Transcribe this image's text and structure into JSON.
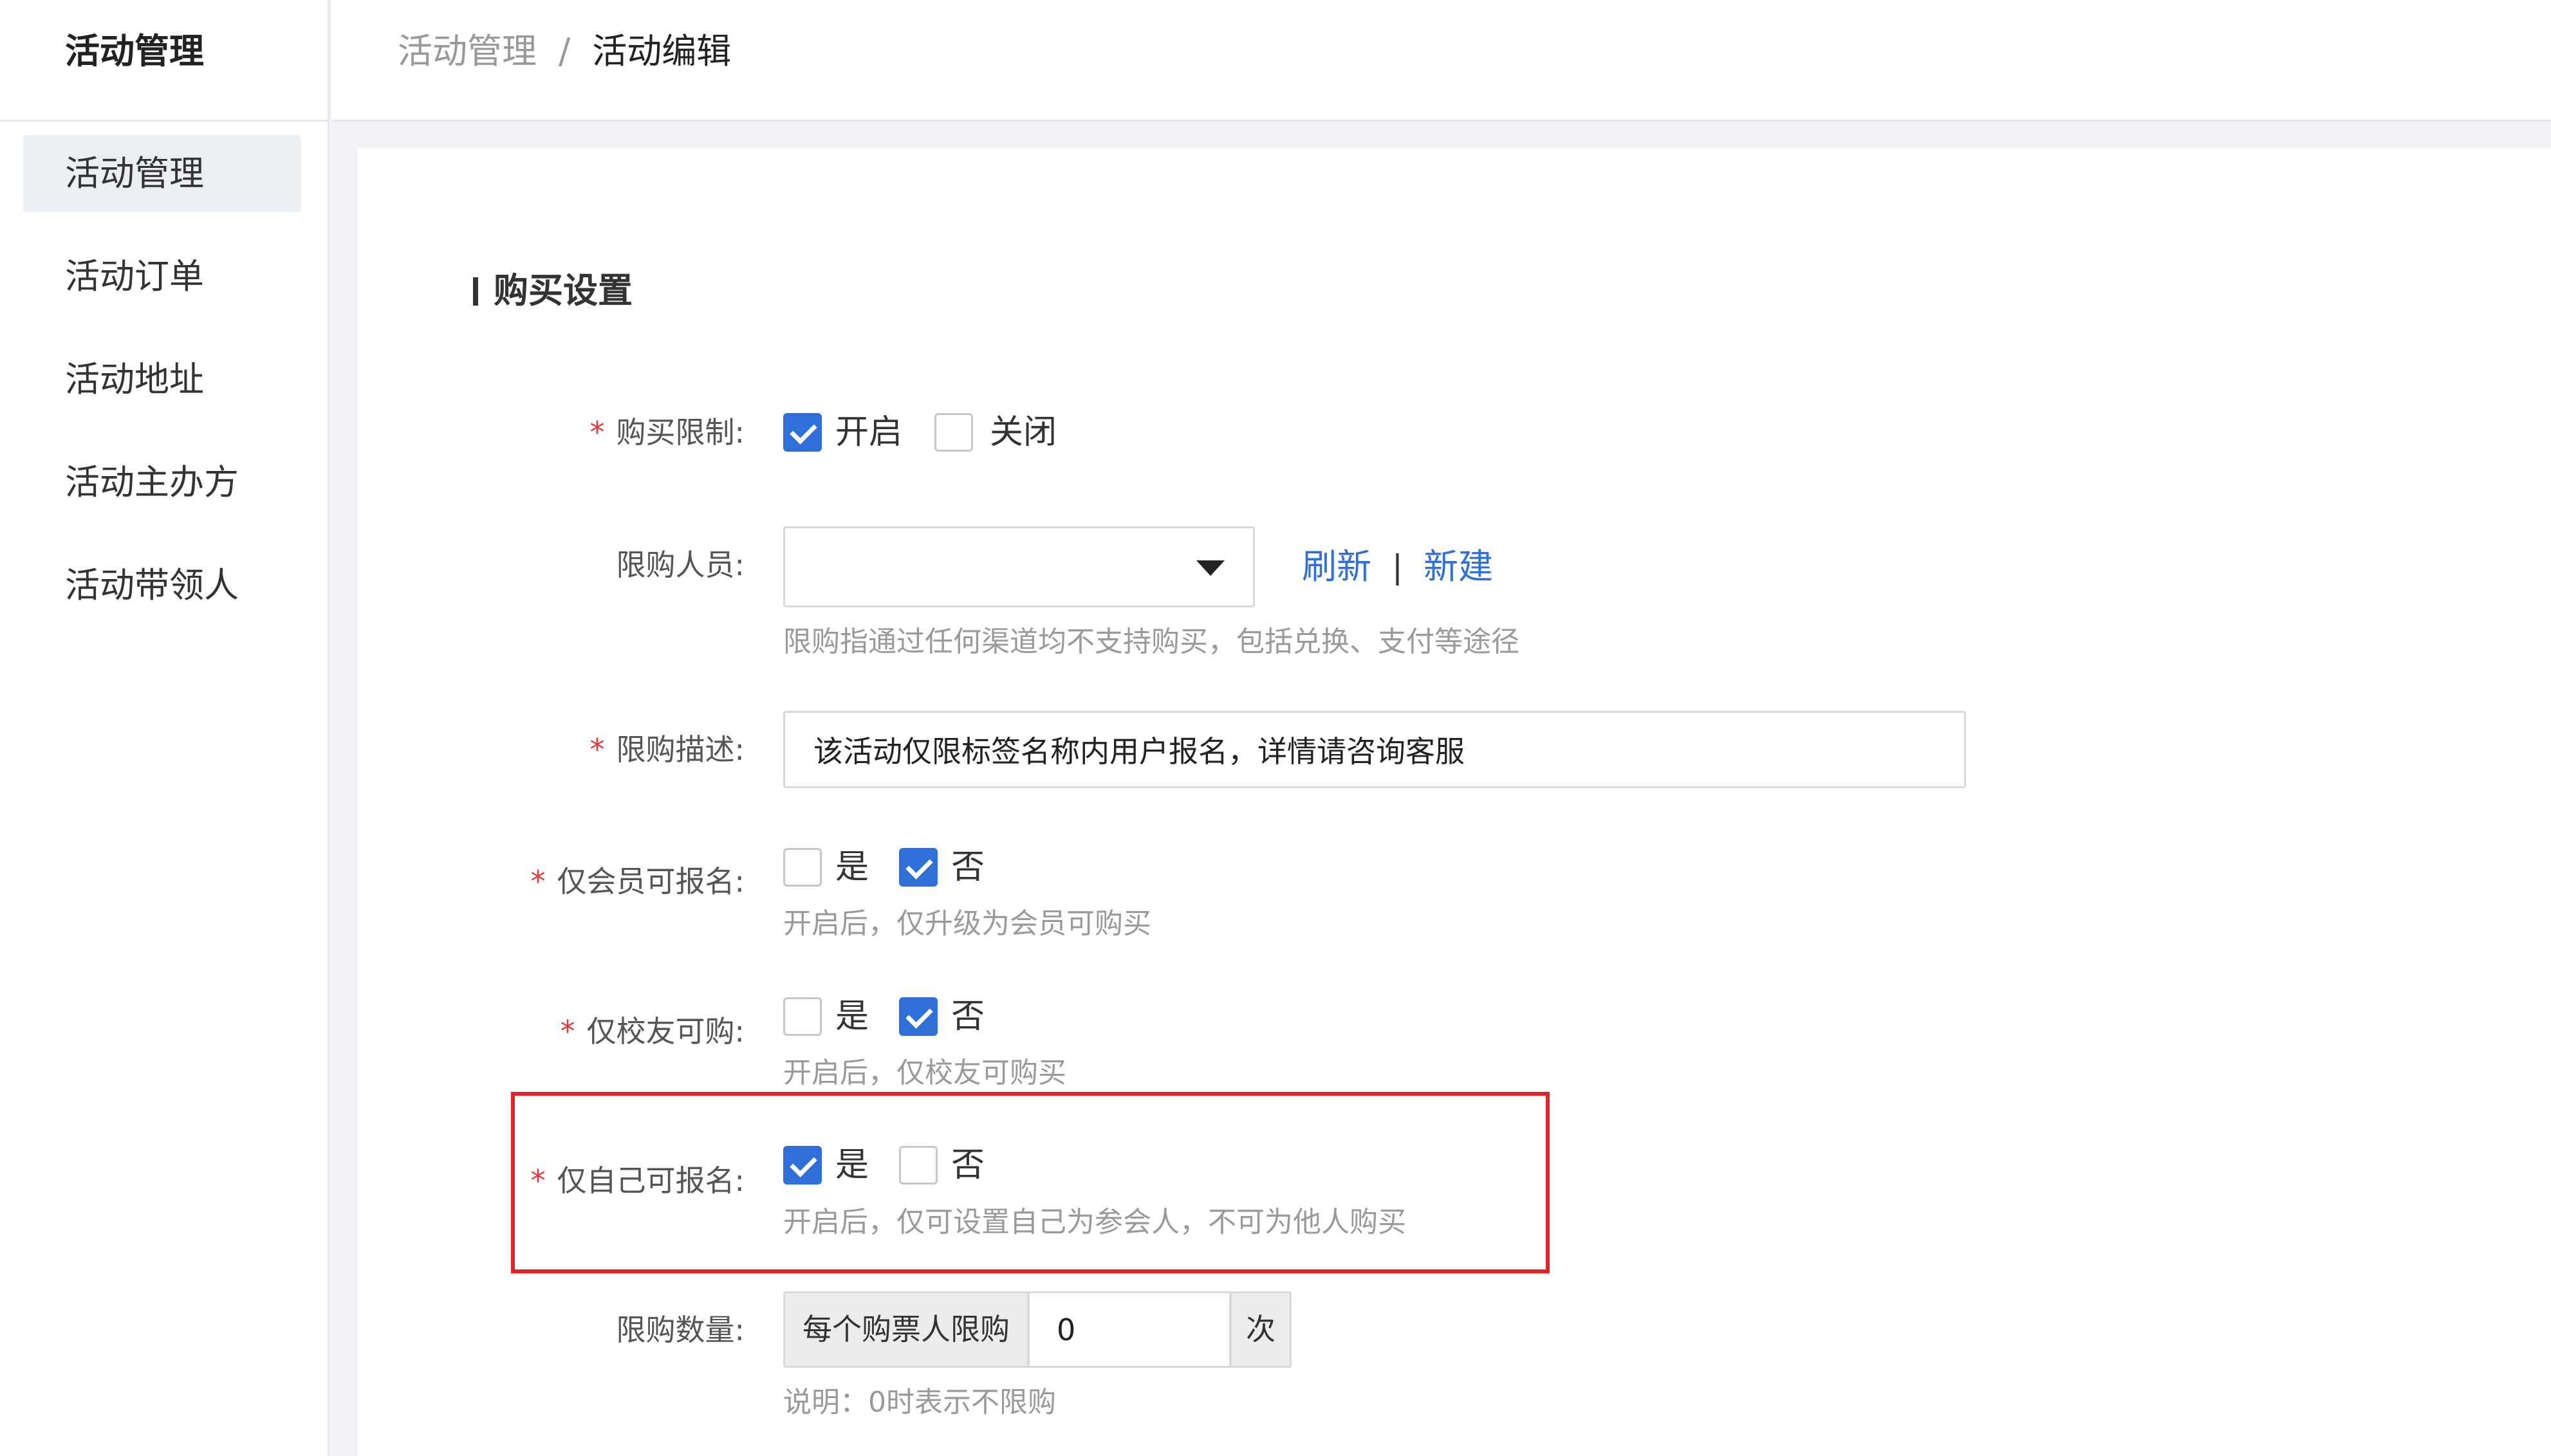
{
  "sidebar": {
    "title": "活动管理",
    "items": [
      {
        "label": "活动管理",
        "active": true
      },
      {
        "label": "活动订单",
        "active": false
      },
      {
        "label": "活动地址",
        "active": false
      },
      {
        "label": "活动主办方",
        "active": false
      },
      {
        "label": "活动带领人",
        "active": false
      }
    ]
  },
  "breadcrumb": {
    "parent": "活动管理",
    "separator": "/",
    "current": "活动编辑"
  },
  "section": {
    "title": "购买设置"
  },
  "form": {
    "purchase_limit": {
      "label": "购买限制:",
      "required": "*",
      "options": [
        {
          "label": "开启",
          "checked": true
        },
        {
          "label": "关闭",
          "checked": false
        }
      ]
    },
    "limited_people": {
      "label": "限购人员:",
      "selected": "",
      "refresh_link": "刷新",
      "link_separator": "|",
      "new_link": "新建",
      "hint": "限购指通过任何渠道均不支持购买，包括兑换、支付等途径"
    },
    "limit_desc": {
      "label": "限购描述:",
      "required": "*",
      "value": "该活动仅限标签名称内用户报名，详情请咨询客服"
    },
    "members_only": {
      "label": "仅会员可报名:",
      "required": "*",
      "options": [
        {
          "label": "是",
          "checked": false
        },
        {
          "label": "否",
          "checked": true
        }
      ],
      "hint": "开启后，仅升级为会员可购买"
    },
    "alumni_only": {
      "label": "仅校友可购:",
      "required": "*",
      "options": [
        {
          "label": "是",
          "checked": false
        },
        {
          "label": "否",
          "checked": true
        }
      ],
      "hint": "开启后，仅校友可购买"
    },
    "self_only": {
      "label": "仅自己可报名:",
      "required": "*",
      "options": [
        {
          "label": "是",
          "checked": true
        },
        {
          "label": "否",
          "checked": false
        }
      ],
      "hint": "开启后，仅可设置自己为参会人，不可为他人购买"
    },
    "limit_qty": {
      "label": "限购数量:",
      "prefix": "每个购票人限购",
      "value": "0",
      "suffix": "次",
      "hint": "说明：0时表示不限购"
    }
  },
  "colors": {
    "accent": "#2f6fd8",
    "required": "#e4393c",
    "highlight_border": "#e0242a"
  }
}
